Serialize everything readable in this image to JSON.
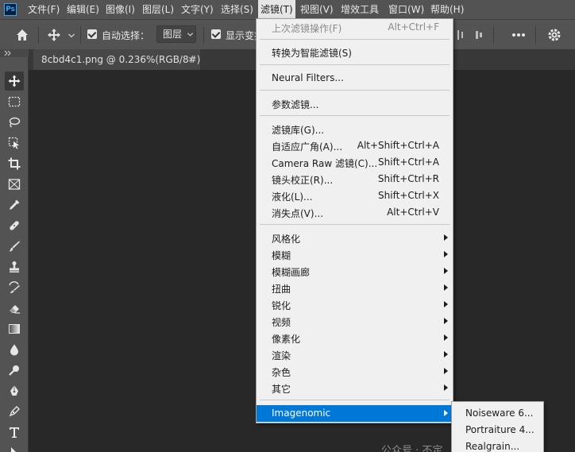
{
  "app": {
    "logo": "Ps"
  },
  "menubar": {
    "items": [
      {
        "label": "文件(F)"
      },
      {
        "label": "编辑(E)"
      },
      {
        "label": "图像(I)"
      },
      {
        "label": "图层(L)"
      },
      {
        "label": "文字(Y)"
      },
      {
        "label": "选择(S)"
      },
      {
        "label": "滤镜(T)",
        "active": true
      },
      {
        "label": "视图(V)"
      },
      {
        "label": "增效工具"
      },
      {
        "label": "窗口(W)"
      },
      {
        "label": "帮助(H)"
      }
    ]
  },
  "options": {
    "auto_select_label": "自动选择：",
    "layer_select_value": "图层",
    "show_transform_label": "显示变换控件"
  },
  "document": {
    "tab_title": "8cbd4c1.png @ 0.236%(RGB/8#)",
    "close_glyph": "×"
  },
  "filter_menu": {
    "items": [
      {
        "label": "上次滤镜操作(F)",
        "shortcut": "Alt+Ctrl+F",
        "disabled": true
      },
      {
        "label": "转换为智能滤镜(S)"
      },
      {
        "label": "Neural Filters..."
      },
      {
        "label": "参数滤镜..."
      },
      {
        "label": "滤镜库(G)..."
      },
      {
        "label": "自适应广角(A)...",
        "shortcut": "Alt+Shift+Ctrl+A"
      },
      {
        "label": "Camera Raw 滤镜(C)...",
        "shortcut": "Shift+Ctrl+A"
      },
      {
        "label": "镜头校正(R)...",
        "shortcut": "Shift+Ctrl+R"
      },
      {
        "label": "液化(L)...",
        "shortcut": "Shift+Ctrl+X"
      },
      {
        "label": "消失点(V)...",
        "shortcut": "Alt+Ctrl+V"
      },
      {
        "label": "风格化",
        "submenu": true
      },
      {
        "label": "模糊",
        "submenu": true
      },
      {
        "label": "模糊画廊",
        "submenu": true
      },
      {
        "label": "扭曲",
        "submenu": true
      },
      {
        "label": "锐化",
        "submenu": true
      },
      {
        "label": "视频",
        "submenu": true
      },
      {
        "label": "像素化",
        "submenu": true
      },
      {
        "label": "渲染",
        "submenu": true
      },
      {
        "label": "杂色",
        "submenu": true
      },
      {
        "label": "其它",
        "submenu": true
      },
      {
        "label": "Imagenomic",
        "submenu": true,
        "highlighted": true
      }
    ]
  },
  "imagenomic_submenu": {
    "items": [
      {
        "label": "Noiseware 6..."
      },
      {
        "label": "Portraiture 4..."
      },
      {
        "label": "Realgrain..."
      }
    ]
  },
  "watermark": {
    "text": "公众号 · 不定",
    "color": "#8d8d8d"
  },
  "colors": {
    "highlight": "#0078d7",
    "panel": "#535353",
    "canvas": "#282828"
  }
}
